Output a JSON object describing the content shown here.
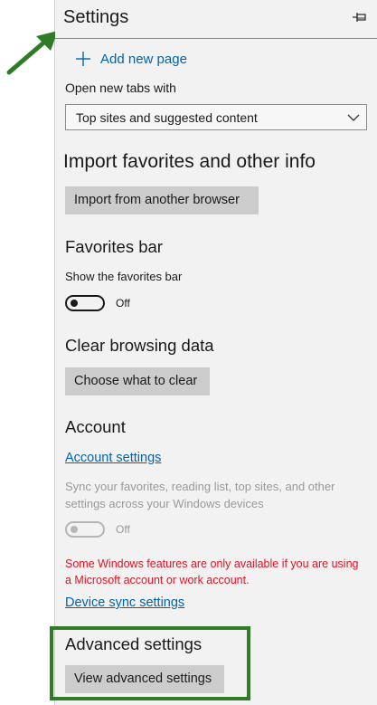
{
  "settings_panel": {
    "title": "Settings",
    "pin_icon": "pin-icon",
    "add_new_page": "Add new page",
    "open_new_tabs_label": "Open new tabs with",
    "open_new_tabs_value": "Top sites and suggested content",
    "import_heading": "Import favorites and other info",
    "import_button": "Import from another browser",
    "favorites_bar_heading": "Favorites bar",
    "show_favorites_label": "Show the favorites bar",
    "show_favorites_state": "Off",
    "clear_heading": "Clear browsing data",
    "clear_button": "Choose what to clear",
    "account_heading": "Account",
    "account_settings_link": "Account settings",
    "sync_line_1": "Sync your favorites, reading list, top sites, and other",
    "sync_line_2": "settings across your Windows devices",
    "sync_state": "Off",
    "warning_line_1": "Some Windows features are only available if you are using",
    "warning_line_2": "a Microsoft account or work account.",
    "device_sync_link": "Device sync settings",
    "advanced_heading": "Advanced settings",
    "advanced_button": "View advanced settings"
  },
  "annotations": {
    "arrow_color": "#2d7d27",
    "highlight_color": "#2d7d27"
  }
}
